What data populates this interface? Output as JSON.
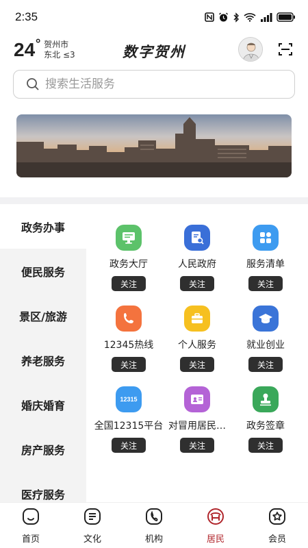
{
  "status_bar": {
    "time": "2:35",
    "icons": [
      "nfc-icon",
      "alarm-icon",
      "bluetooth-icon",
      "wifi-icon",
      "signal-icon",
      "battery-icon"
    ]
  },
  "header": {
    "temperature": "24",
    "temperature_unit": "°",
    "city": "贺州市",
    "wind": "东北 ≤3",
    "title": "数字贺州"
  },
  "search": {
    "placeholder": "搜索生活服务"
  },
  "side_menu": {
    "items": [
      {
        "label": "政务办事",
        "active": true
      },
      {
        "label": "便民服务",
        "active": false
      },
      {
        "label": "景区/旅游",
        "active": false
      },
      {
        "label": "养老服务",
        "active": false
      },
      {
        "label": "婚庆婚育",
        "active": false
      },
      {
        "label": "房产服务",
        "active": false
      },
      {
        "label": "医疗服务",
        "active": false
      }
    ]
  },
  "services": [
    {
      "label": "政务大厅",
      "follow": "关注",
      "icon": "monitor-icon",
      "color": "#5cc26a"
    },
    {
      "label": "人民政府",
      "follow": "关注",
      "icon": "document-search-icon",
      "color": "#3a6fd8"
    },
    {
      "label": "服务清单",
      "follow": "关注",
      "icon": "apps-grid-icon",
      "color": "#3d9bf0"
    },
    {
      "label": "12345热线",
      "follow": "关注",
      "icon": "phone-icon",
      "color": "#f4733e"
    },
    {
      "label": "个人服务",
      "follow": "关注",
      "icon": "briefcase-icon",
      "color": "#f6c020"
    },
    {
      "label": "就业创业",
      "follow": "关注",
      "icon": "graduation-cap-icon",
      "color": "#3a74d8"
    },
    {
      "label": "全国12315平台",
      "follow": "关注",
      "icon": "12315-icon",
      "icon_text": "12315",
      "color": "#3d9bf0"
    },
    {
      "label": "对冒用居民…",
      "follow": "关注",
      "icon": "id-card-icon",
      "color": "#b463d6"
    },
    {
      "label": "政务签章",
      "follow": "关注",
      "icon": "stamp-icon",
      "color": "#3aa85a"
    }
  ],
  "bottom_nav": {
    "items": [
      {
        "label": "首页",
        "icon": "home-icon",
        "active": false
      },
      {
        "label": "文化",
        "icon": "culture-icon",
        "active": false
      },
      {
        "label": "机构",
        "icon": "institution-icon",
        "active": false
      },
      {
        "label": "居民",
        "icon": "resident-icon",
        "active": true
      },
      {
        "label": "会员",
        "icon": "member-icon",
        "active": false
      }
    ]
  },
  "colors": {
    "accent": "#b0252b",
    "button_dark": "#2f2f2f",
    "side_bg": "#f3f3f3"
  }
}
